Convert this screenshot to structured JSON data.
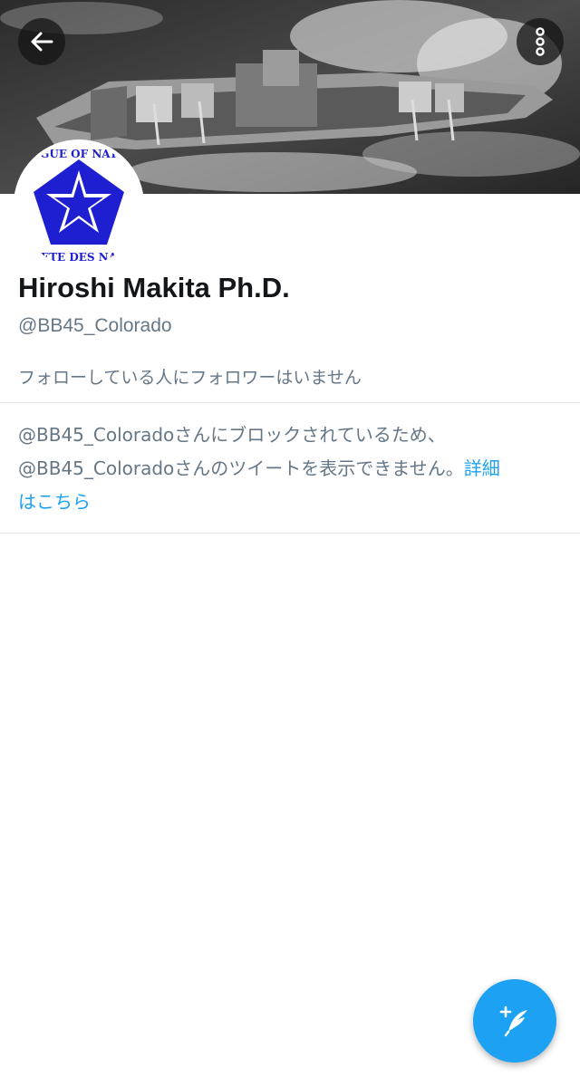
{
  "header": {
    "back_icon": "arrow-left-icon",
    "more_icon": "more-vertical-icon"
  },
  "profile": {
    "avatar_text_top": "GUE OF NAT",
    "avatar_text_bottom": "ETE DES NA",
    "name": "Hiroshi Makita Ph.D.",
    "handle": "@BB45_Colorado",
    "follow_note": "フォローしている人にフォロワーはいません"
  },
  "blocked": {
    "line1": "@BB45_Coloradoさんにブロックされているため、",
    "line2_text": "@BB45_Coloradoさんのツイートを表示できません。",
    "learn_more_part1": "詳細",
    "learn_more_part2": "はこちら"
  },
  "fab": {
    "icon": "compose-tweet-icon"
  },
  "colors": {
    "accent": "#1da1f2",
    "secondary_text": "#657786",
    "primary_text": "#14171a"
  }
}
